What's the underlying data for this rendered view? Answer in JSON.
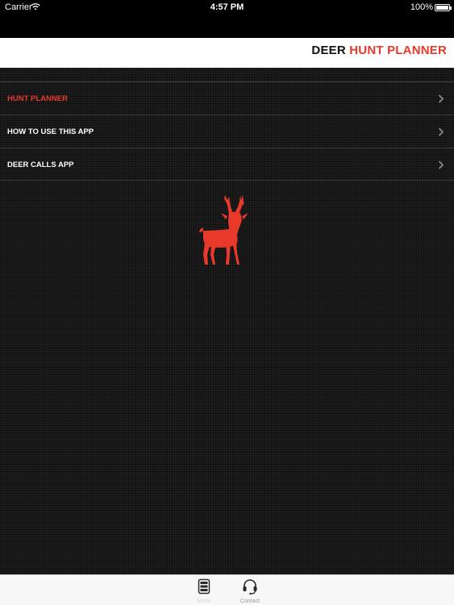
{
  "status_bar": {
    "carrier": "Carrier",
    "time": "4:57 PM",
    "battery": "100%",
    "battery_level": 1.0
  },
  "header": {
    "title_part1": "DEER",
    "title_part2": "HUNT PLANNER",
    "background": "#ffffff",
    "accent_color": "#e8392b"
  },
  "menu": {
    "items": [
      {
        "label": "HUNT PLANNER",
        "active": true
      },
      {
        "label": "HOW TO USE THIS APP",
        "active": false
      },
      {
        "label": "DEER CALLS APP",
        "active": false
      }
    ]
  },
  "logo": {
    "icon": "deer-icon",
    "color": "#e8392b"
  },
  "tab_bar": {
    "tabs": [
      {
        "label": "Menu",
        "icon": "menu-list-icon",
        "selected": true
      },
      {
        "label": "Contact",
        "icon": "headset-icon",
        "selected": false
      }
    ]
  }
}
